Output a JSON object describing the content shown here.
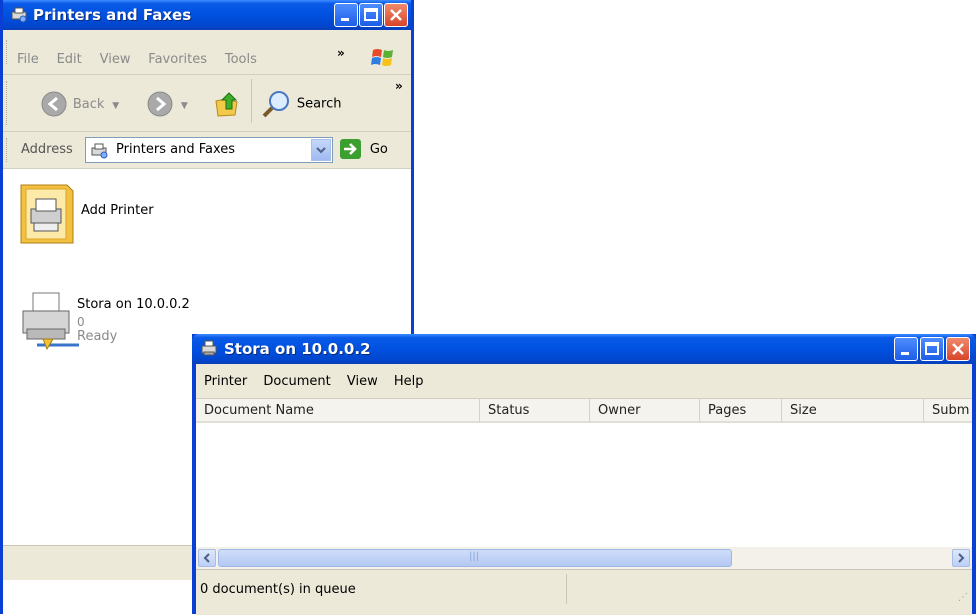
{
  "printers_window": {
    "title": "Printers and Faxes",
    "menu": [
      "File",
      "Edit",
      "View",
      "Favorites",
      "Tools"
    ],
    "toolbar": {
      "back_label": "Back",
      "search_label": "Search"
    },
    "address": {
      "label": "Address",
      "value": "Printers and Faxes",
      "go_label": "Go"
    },
    "items": [
      {
        "name": "Add Printer"
      },
      {
        "name": "Stora on 10.0.0.2",
        "documents": "0",
        "status": "Ready"
      }
    ]
  },
  "queue_window": {
    "title": "Stora on 10.0.0.2",
    "menu": [
      "Printer",
      "Document",
      "View",
      "Help"
    ],
    "columns": [
      "Document Name",
      "Status",
      "Owner",
      "Pages",
      "Size",
      "Subm"
    ],
    "status_text": "0 document(s) in queue"
  },
  "colors": {
    "titlebar_blue": "#0151e0",
    "face": "#ece9d8",
    "close_red": "#d8452a"
  }
}
